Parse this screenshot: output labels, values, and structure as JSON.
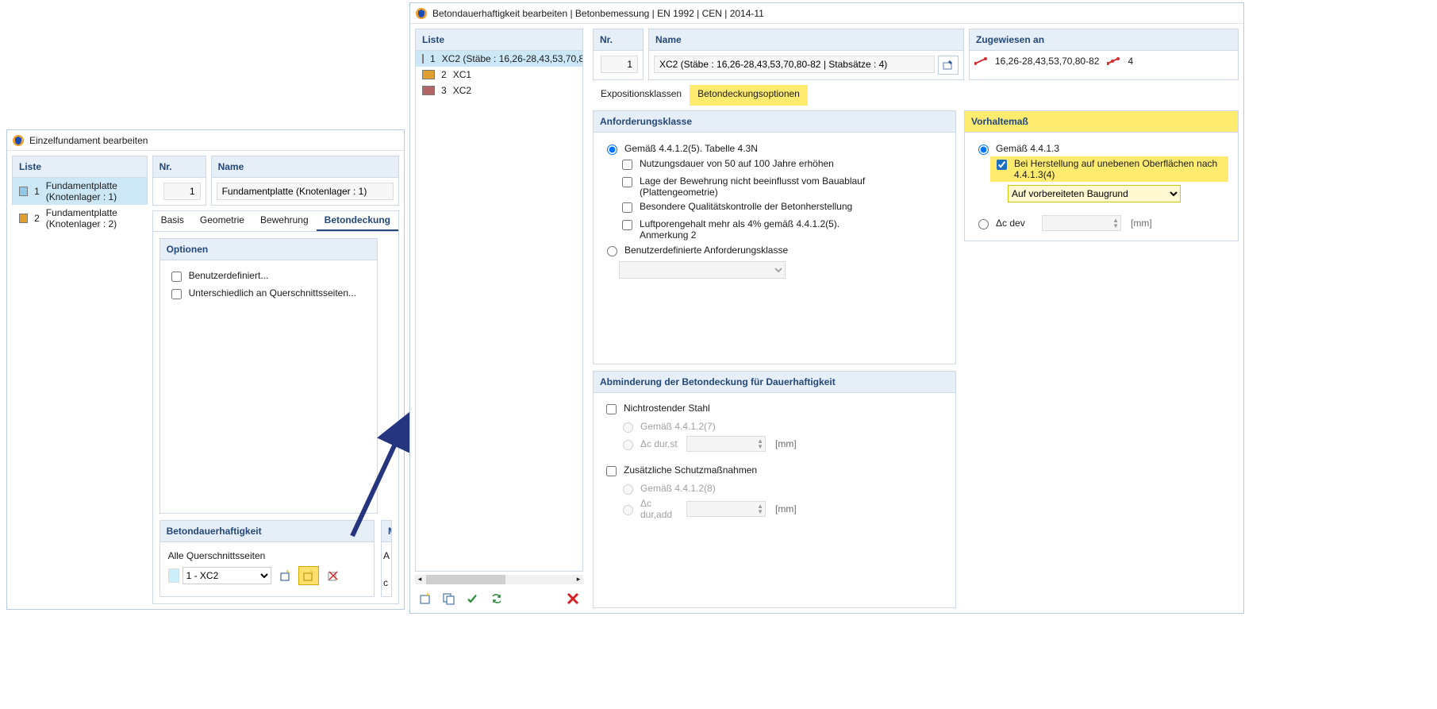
{
  "dlg1": {
    "title": "Einzelfundament bearbeiten",
    "liste_hdr": "Liste",
    "nr_hdr": "Nr.",
    "name_hdr": "Name",
    "listItems": [
      {
        "n": "1",
        "label": "Fundamentplatte (Knotenlager : 1)",
        "color": "#8ec9e8"
      },
      {
        "n": "2",
        "label": "Fundamentplatte (Knotenlager : 2)",
        "color": "#e0a030"
      }
    ],
    "nrVal": "1",
    "nameVal": "Fundamentplatte (Knotenlager : 1)",
    "tabs": {
      "basis": "Basis",
      "geom": "Geometrie",
      "bew": "Bewehrung",
      "deck": "Betondeckung"
    },
    "optHdr": "Optionen",
    "opt1": "Benutzerdefiniert...",
    "opt2": "Unterschiedlich an Querschnittsseiten...",
    "durHdr": "Betondauerhaftigkeit",
    "allSides": "Alle Querschnittsseiten",
    "durOpt": "1 - XC2",
    "mHdr": "M",
    "aLbl": "A",
    "cLbl": "c"
  },
  "dlg2": {
    "title": "Betondauerhaftigkeit bearbeiten | Betonbemessung | EN 1992 | CEN | 2014-11",
    "liste_hdr": "Liste",
    "nr_hdr": "Nr.",
    "name_hdr": "Name",
    "zug_hdr": "Zugewiesen an",
    "listItems": [
      {
        "n": "1",
        "label": "XC2 (Stäbe : 16,26-28,43,53,70,80-8",
        "color": "#59a8d8"
      },
      {
        "n": "2",
        "label": "XC1",
        "color": "#e0a030"
      },
      {
        "n": "3",
        "label": "XC2",
        "color": "#b36666"
      }
    ],
    "nrVal": "1",
    "nameVal": "XC2 (Stäbe : 16,26-28,43,53,70,80-82 | Stabsätze : 4)",
    "zugA": "16,26-28,43,53,70,80-82",
    "zugB": "4",
    "tabs": {
      "exp": "Expositionsklassen",
      "cov": "Betondeckungsoptionen"
    },
    "sec1": "Anforderungsklasse",
    "r1": "Gemäß 4.4.1.2(5). Tabelle 4.3N",
    "c1": "Nutzungsdauer von 50 auf 100 Jahre erhöhen",
    "c2": "Lage der Bewehrung nicht beeinflusst vom Bauablauf (Plattengeometrie)",
    "c3": "Besondere Qualitätskontrolle der Betonherstellung",
    "c4": "Luftporengehalt mehr als 4% gemäß 4.4.1.2(5). Anmerkung 2",
    "r2": "Benutzerdefinierte Anforderungsklasse",
    "sec2": "Abminderung der Betondeckung für Dauerhaftigkeit",
    "c5": "Nichtrostender Stahl",
    "r3": "Gemäß 4.4.1.2(7)",
    "l1": "Δc dur,st",
    "c6": "Zusätzliche Schutzmaßnahmen",
    "r4": "Gemäß 4.4.1.2(8)",
    "l2": "Δc dur,add",
    "mm": "[mm]",
    "sec3": "Vorhaltemaß",
    "r5": "Gemäß 4.4.1.3",
    "c7": "Bei Herstellung auf unebenen Oberflächen nach 4.4.1.3(4)",
    "sel": "Auf vorbereiteten Baugrund",
    "r6": "Δc dev"
  }
}
